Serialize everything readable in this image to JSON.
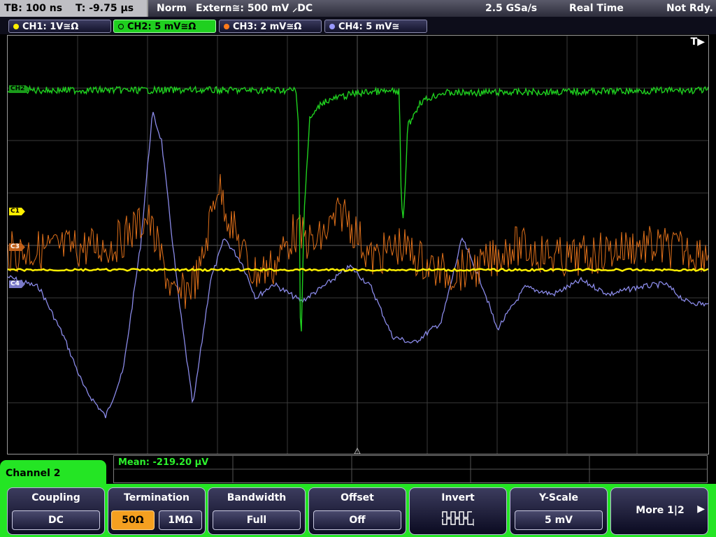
{
  "topbar": {
    "timebase": "TB: 100 ns",
    "trigger_time": "T: -9.75 µs",
    "mode": "Norm",
    "trigger": "Extern≅: 500 mV ⸝DC",
    "sample_rate": "2.5 GSa/s",
    "acq_mode": "Real Time",
    "status": "Not Rdy."
  },
  "channels": [
    {
      "label": "CH1: 1V≅Ω",
      "color": "#ffef00"
    },
    {
      "label": "CH2: 5 mV≅Ω",
      "color": "#1fd01f"
    },
    {
      "label": "CH3: 2 mV≅Ω",
      "color": "#ff7a1a"
    },
    {
      "label": "CH4: 5 mV≅",
      "color": "#9a9aff"
    }
  ],
  "markers": {
    "c1": "C1",
    "c3": "C3",
    "c4": "C4",
    "ch2": "CH2"
  },
  "trigger_marker": "T▶",
  "measurement": "Mean: -219.20 µV",
  "menu": {
    "title": "Channel 2",
    "coupling_label": "Coupling",
    "coupling_value": "DC",
    "termination_label": "Termination",
    "term_50": "50Ω",
    "term_1m": "1MΩ",
    "bandwidth_label": "Bandwidth",
    "bandwidth_value": "Full",
    "offset_label": "Offset",
    "offset_value": "Off",
    "invert_label": "Invert",
    "yscale_label": "Y-Scale",
    "yscale_value": "5 mV",
    "more_label": "More 1|2"
  }
}
